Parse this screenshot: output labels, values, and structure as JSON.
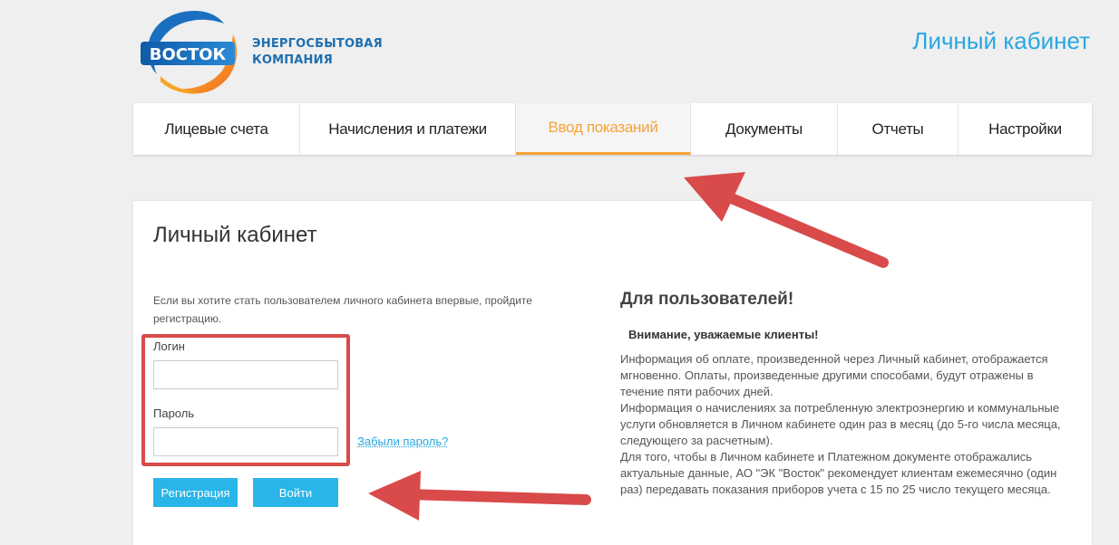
{
  "header": {
    "logo_word": "ВОСТОК",
    "company_line1": "ЭНЕРГОСБЫТОВАЯ",
    "company_line2": "КОМПАНИЯ",
    "cabinet_title": "Личный кабинет"
  },
  "nav": {
    "items": [
      {
        "label": "Лицевые счета"
      },
      {
        "label": "Начисления и платежи"
      },
      {
        "label": "Ввод показаний"
      },
      {
        "label": "Документы"
      },
      {
        "label": "Отчеты"
      },
      {
        "label": "Настройки"
      }
    ],
    "active_index": 2
  },
  "login": {
    "title": "Личный кабинет",
    "intro": "Если вы хотите стать пользователем личного кабинета впервые, пройдите регистрацию.",
    "login_label": "Логин",
    "login_value": "",
    "password_label": "Пароль",
    "password_value": "",
    "forgot_label": "Забыли пароль?",
    "register_label": "Регистрация",
    "submit_label": "Войти"
  },
  "info": {
    "heading": "Для пользователей!",
    "subheading": "Внимание, уважаемые клиенты!",
    "paragraph1": "Информация об оплате, произведенной через Личный кабинет, отображается мгновенно. Оплаты, произведенные другими способами, будут отражены в течение пяти рабочих дней.",
    "paragraph2": "Информация о начислениях за потребленную электроэнергию и коммунальные услуги обновляется в Личном кабинете один раз в месяц (до 5-го числа месяца, следующего за расчетным).",
    "paragraph3": "Для того, чтобы в Личном кабинете и Платежном документе отображались актуальные данные, АО \"ЭК \"Восток\" рекомендует клиентам ежемесячно (один раз) передавать показания приборов учета с 15 по 25 число текущего месяца."
  },
  "colors": {
    "accent": "#29a7e1",
    "active_tab": "#f7a33a",
    "annotation": "#d94a4a",
    "button": "#29b5e8"
  }
}
